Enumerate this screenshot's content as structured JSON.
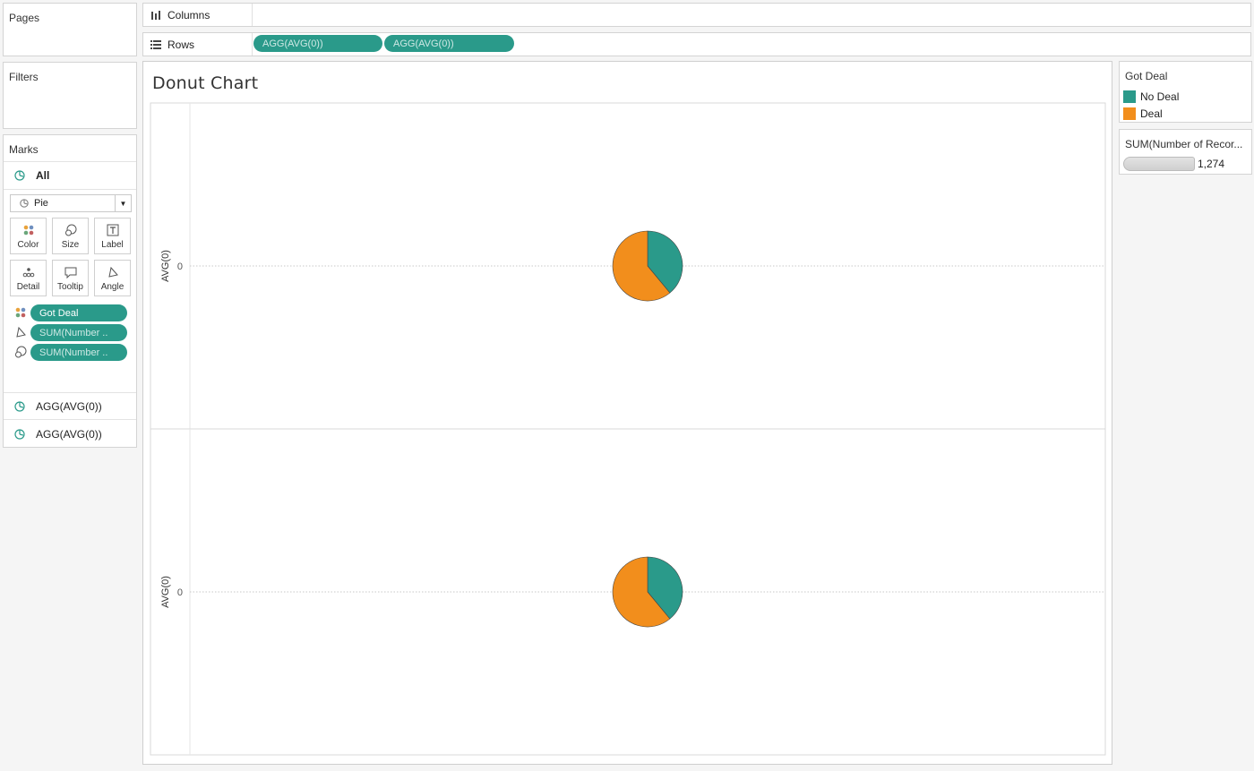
{
  "pages": {
    "title": "Pages"
  },
  "filters": {
    "title": "Filters"
  },
  "marks": {
    "title": "Marks",
    "all_label": "All",
    "mark_type": "Pie",
    "buttons": [
      {
        "label": "Color",
        "icon": "color-dots-icon"
      },
      {
        "label": "Size",
        "icon": "size-icon"
      },
      {
        "label": "Label",
        "icon": "label-icon"
      },
      {
        "label": "Detail",
        "icon": "detail-icon"
      },
      {
        "label": "Tooltip",
        "icon": "tooltip-icon"
      },
      {
        "label": "Angle",
        "icon": "angle-icon"
      }
    ],
    "pills": [
      {
        "label": "Got Deal",
        "icon": "color-dots-icon"
      },
      {
        "label": "SUM(Number ..",
        "icon": "angle-icon"
      },
      {
        "label": "SUM(Number ..",
        "icon": "size-icon"
      }
    ],
    "cards": [
      {
        "label": "AGG(AVG(0))"
      },
      {
        "label": "AGG(AVG(0))"
      }
    ]
  },
  "columns_shelf": {
    "label": "Columns",
    "pills": []
  },
  "rows_shelf": {
    "label": "Rows",
    "pills": [
      "AGG(AVG(0))",
      "AGG(AVG(0))"
    ]
  },
  "view": {
    "title": "Donut Chart"
  },
  "legend": {
    "title": "Got Deal",
    "items": [
      {
        "label": "No Deal",
        "color": "#2a9a8a"
      },
      {
        "label": "Deal",
        "color": "#f28e1c"
      }
    ]
  },
  "size_legend": {
    "title": "SUM(Number of Recor...",
    "value": "1,274"
  },
  "colors": {
    "accent": "#2a9a8a",
    "no_deal": "#2a9a8a",
    "deal": "#f28e1c"
  },
  "chart_data": {
    "type": "pie",
    "panes": [
      {
        "ylabel": "AVG(0)",
        "tick": "0",
        "slices": [
          {
            "name": "No Deal",
            "value": 0.39
          },
          {
            "name": "Deal",
            "value": 0.61
          }
        ]
      },
      {
        "ylabel": "AVG(0)",
        "tick": "0",
        "slices": [
          {
            "name": "No Deal",
            "value": 0.39
          },
          {
            "name": "Deal",
            "value": 0.61
          }
        ]
      }
    ],
    "grid": true
  }
}
